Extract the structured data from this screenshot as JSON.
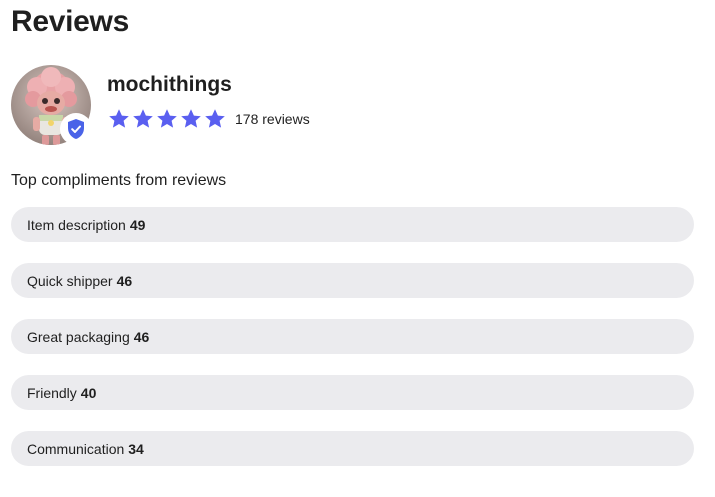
{
  "page": {
    "title": "Reviews"
  },
  "seller": {
    "name": "mochithings",
    "rating_stars": 5,
    "reviews_label": "178 reviews",
    "avatar_icon": "doll-avatar-photo",
    "badge_icon": "verified-shield-icon"
  },
  "compliments": {
    "heading": "Top compliments from reviews",
    "items": [
      {
        "label": "Item description",
        "count": "49"
      },
      {
        "label": "Quick shipper",
        "count": "46"
      },
      {
        "label": "Great packaging",
        "count": "46"
      },
      {
        "label": "Friendly",
        "count": "40"
      },
      {
        "label": "Communication",
        "count": "34"
      }
    ]
  },
  "colors": {
    "star": "#5a5ff0",
    "badge": "#4a63e8",
    "pill_bg": "#ebebee",
    "text": "#1f1f1f"
  }
}
